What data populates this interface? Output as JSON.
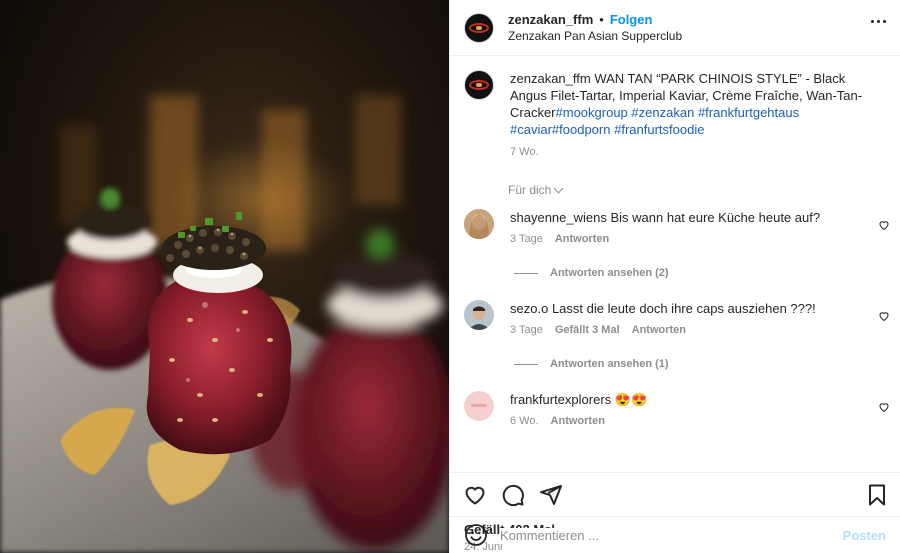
{
  "post": {
    "username": "zenzakan_ffm",
    "separator": "•",
    "follow_label": "Folgen",
    "location": "Zenzakan Pan Asian Supperclub"
  },
  "caption": {
    "username": "zenzakan_ffm",
    "text": "WAN TAN “PARK CHINOIS STYLE” - Black Angus Filet-Tartar, Imperial Kaviar, Crème Fraîche, Wan-Tan-Cracker",
    "tags": [
      "#mookgroup",
      "#zenzakan",
      "#frankfurtgehtaus",
      "#caviar",
      "#foodporn",
      "#franfurtsfoodie"
    ],
    "age": "7 Wo."
  },
  "translate_label": "Für dich",
  "comments": [
    {
      "username": "shayenne_wiens",
      "text": "Bis wann hat eure Küche heute auf?",
      "age": "3 Tage",
      "likes": "",
      "reply_label": "Antworten",
      "view_replies": "Antworten ansehen (2)"
    },
    {
      "username": "sezo.o",
      "text": "Lasst die leute doch ihre caps ausziehen ???!",
      "age": "3 Tage",
      "likes": "Gefällt 3 Mal",
      "reply_label": "Antworten",
      "view_replies": "Antworten ansehen (1)"
    },
    {
      "username": "frankfurtexplorers",
      "text": "😍😍",
      "age": "6 Wo.",
      "likes": "",
      "reply_label": "Antworten",
      "view_replies": ""
    }
  ],
  "icons": {
    "like": "heart-icon",
    "comment": "comment-bubble-icon",
    "share": "paper-plane-icon",
    "save": "bookmark-icon",
    "more": "more-dots-icon",
    "emoji": "emoji-icon"
  },
  "likes_label": "Gefällt 402 Mal",
  "post_date": "24. Juni",
  "composer": {
    "placeholder": "Kommentieren ...",
    "post_label": "Posten"
  },
  "colors": {
    "accent": "#0095f6",
    "hashtag": "#1a5fb4",
    "muted": "#8e8e8e",
    "post_disabled": "#b2dffc"
  }
}
